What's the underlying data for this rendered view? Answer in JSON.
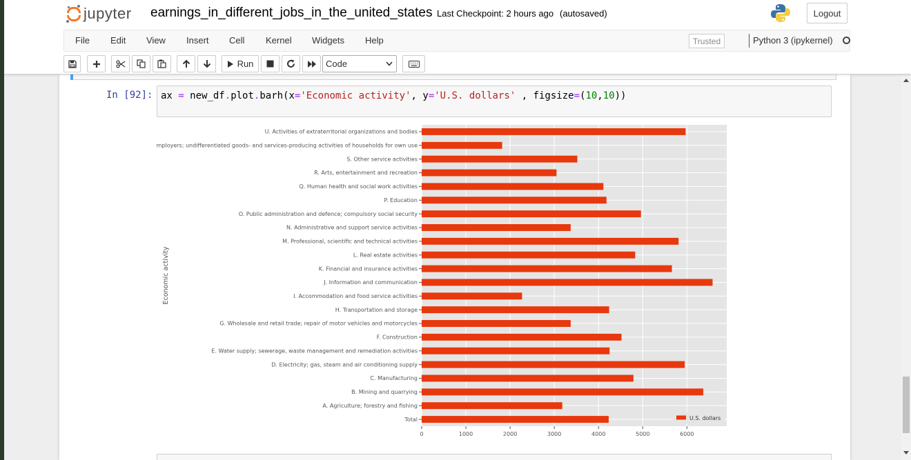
{
  "header": {
    "logo_text": "jupyter",
    "notebook_title": "earnings_in_different_jobs_in_the_united_states",
    "checkpoint": "Last Checkpoint: 2 hours ago",
    "autosave": "(autosaved)",
    "logout_label": "Logout"
  },
  "menu": {
    "items": [
      "File",
      "Edit",
      "View",
      "Insert",
      "Cell",
      "Kernel",
      "Widgets",
      "Help"
    ],
    "trusted": "Trusted",
    "kernel": "Python 3 (ipykernel)"
  },
  "toolbar": {
    "run_label": "Run",
    "cell_type": "Code",
    "icons": [
      "save-icon",
      "plus-icon",
      "cut-icon",
      "copy-icon",
      "paste-icon",
      "arrow-up-icon",
      "arrow-down-icon",
      "run-icon",
      "stop-icon",
      "restart-icon",
      "fast-forward-icon",
      "keyboard-icon"
    ]
  },
  "cell": {
    "prompt": "In [92]:",
    "code_tokens": [
      {
        "t": "ax ",
        "c": ""
      },
      {
        "t": "=",
        "c": "op"
      },
      {
        "t": " new_df",
        "c": ""
      },
      {
        "t": ".",
        "c": "op"
      },
      {
        "t": "plot",
        "c": ""
      },
      {
        "t": ".",
        "c": "op"
      },
      {
        "t": "barh(x",
        "c": ""
      },
      {
        "t": "=",
        "c": "op"
      },
      {
        "t": "'Economic activity'",
        "c": "str"
      },
      {
        "t": ", y",
        "c": ""
      },
      {
        "t": "=",
        "c": "op"
      },
      {
        "t": "'U.S. dollars'",
        "c": "str"
      },
      {
        "t": " , figsize",
        "c": ""
      },
      {
        "t": "=",
        "c": "op"
      },
      {
        "t": "(",
        "c": ""
      },
      {
        "t": "10",
        "c": "num"
      },
      {
        "t": ",",
        "c": ""
      },
      {
        "t": "10",
        "c": "num"
      },
      {
        "t": "))",
        "c": ""
      }
    ]
  },
  "chart_data": {
    "type": "bar",
    "orientation": "horizontal",
    "ylabel": "Economic activity",
    "xlabel": "",
    "xlim": [
      0,
      6900
    ],
    "xticks": [
      0,
      1000,
      2000,
      3000,
      4000,
      5000,
      6000
    ],
    "grid": true,
    "legend": "bottom-right",
    "bar_color": "#e8380d",
    "background_color": "#e5e5e5",
    "categories": [
      "Total",
      "A. Agriculture; forestry and fishing",
      "B. Mining and quarrying",
      "C. Manufacturing",
      "D. Electricity; gas, steam and air conditioning supply",
      "E. Water supply; sewerage, waste management and remediation activities",
      "F. Construction",
      "G. Wholesale and retail trade; repair of motor vehicles and motorcycles",
      "H. Transportation and storage",
      "I. Accommodation and food service activities",
      "J. Information and communication",
      "K. Financial and insurance activities",
      "L. Real estate activities",
      "M. Professional, scientific and technical activities",
      "N. Administrative and support service activities",
      "O. Public administration and defence; compulsory social security",
      "P. Education",
      "Q. Human health and social work activities",
      "R. Arts, entertainment and recreation",
      "S. Other service activities",
      "T. Activities of households as employers; undifferentiated goods- and services-producing activities of households for own use",
      "U. Activities of extraterritorial organizations and bodies"
    ],
    "series": [
      {
        "name": "U.S. dollars",
        "values": [
          4230,
          3180,
          6370,
          4790,
          5950,
          4250,
          4520,
          3370,
          4240,
          2270,
          6580,
          5660,
          4830,
          5810,
          3370,
          4960,
          4180,
          4110,
          3050,
          3520,
          1820,
          5970
        ]
      }
    ]
  }
}
